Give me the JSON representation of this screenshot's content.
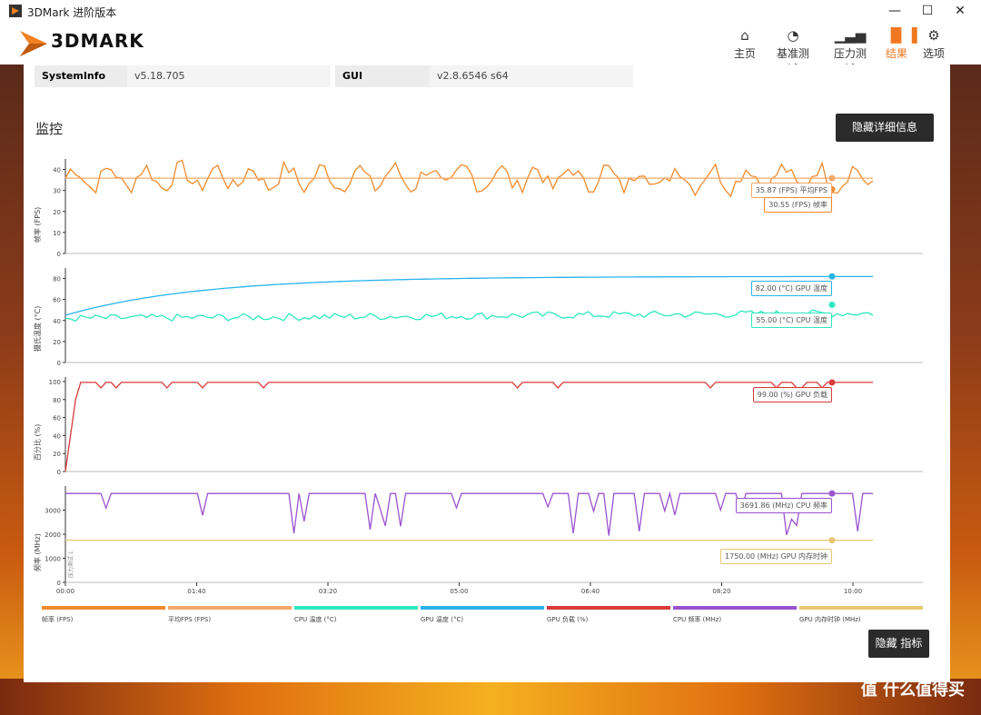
{
  "window": {
    "title": "3DMark 进阶版本",
    "minimize": "—",
    "maximize": "☐",
    "close": "✕"
  },
  "logo": {
    "text": "3DMARK"
  },
  "nav": [
    {
      "label": "主页",
      "icon": "home-icon",
      "glyph": "⌂"
    },
    {
      "label": "基准测试",
      "icon": "gauge-icon",
      "glyph": "◔"
    },
    {
      "label": "压力测试",
      "icon": "bars-icon",
      "glyph": "▁▃▅"
    },
    {
      "label": "结果",
      "icon": "results-icon",
      "glyph": "▐▌▐",
      "active": true
    },
    {
      "label": "选项",
      "icon": "gear-icon",
      "glyph": "⚙"
    }
  ],
  "info": {
    "systeminfo_label": "SystemInfo",
    "systeminfo_value": "v5.18.705",
    "gui_label": "GUI",
    "gui_value": "v2.8.6546 s64"
  },
  "monitor": {
    "title": "监控",
    "hide_details": "隐藏详细信息",
    "hide_metrics": "隐藏 指标"
  },
  "colors": {
    "fps": "#f08a2c",
    "avg_fps": "#f5a868",
    "cpu_temp": "#2ee8c0",
    "gpu_temp": "#29b3ef",
    "gpu_load": "#d93a3a",
    "cpu_clock": "#9a52d0",
    "gpu_mem_clock": "#e8c872"
  },
  "watermark": "值 什么值得买",
  "chart_data": {
    "type": "line",
    "x_ticks": [
      "00:00",
      "01:40",
      "03:20",
      "05:00",
      "06:40",
      "08:20",
      "10:00"
    ],
    "marker_label": "压力测试 1",
    "panels": [
      {
        "ylabel": "帧率 (FPS)",
        "yticks": [
          "0",
          "10",
          "20",
          "30",
          "40"
        ],
        "ylim": [
          0,
          45
        ],
        "series": [
          {
            "name": "帧率 (FPS)",
            "color": "#f08a2c",
            "pattern": "fps",
            "base": 36,
            "amp": 8
          },
          {
            "name": "平均FPS (FPS)",
            "color": "#f5a868",
            "pattern": "flat",
            "base": 35.87
          }
        ],
        "tags": [
          {
            "text": "35.87 (FPS) 平均FPS",
            "color": "#f5a868",
            "value": 35.87
          },
          {
            "text": "30.55 (FPS) 帧率",
            "color": "#f08a2c",
            "value": 30.55
          }
        ]
      },
      {
        "ylabel": "摄氏温度 (°C)",
        "yticks": [
          "0",
          "20",
          "40",
          "60",
          "80"
        ],
        "ylim": [
          0,
          90
        ],
        "series": [
          {
            "name": "GPU 温度 (°C)",
            "color": "#29b3ef",
            "pattern": "warmup",
            "base": 82,
            "start": 45
          },
          {
            "name": "CPU 温度 (°C)",
            "color": "#2ee8c0",
            "pattern": "noisy",
            "base": 42,
            "amp": 7
          }
        ],
        "tags": [
          {
            "text": "82.00 (°C) GPU 温度",
            "color": "#29b3ef",
            "value": 82.0
          },
          {
            "text": "55.00 (°C) CPU 温度",
            "color": "#2ee8c0",
            "value": 55.0
          }
        ]
      },
      {
        "ylabel": "百分比 (%)",
        "yticks": [
          "0",
          "20",
          "40",
          "60",
          "80",
          "100"
        ],
        "ylim": [
          0,
          105
        ],
        "series": [
          {
            "name": "GPU 负载 (%)",
            "color": "#d93a3a",
            "pattern": "load",
            "base": 99
          }
        ],
        "tags": [
          {
            "text": "99.00 (%) GPU 负载",
            "color": "#d93a3a",
            "value": 99.0
          }
        ]
      },
      {
        "ylabel": "频率 (MHz)",
        "yticks": [
          "0",
          "1000",
          "2000",
          "3000"
        ],
        "ylim": [
          0,
          4000
        ],
        "series": [
          {
            "name": "CPU 频率 (MHz)",
            "color": "#9a52d0",
            "pattern": "cpuclock",
            "base": 3691.86
          },
          {
            "name": "GPU 内存时钟 (MHz)",
            "color": "#e8c872",
            "pattern": "flat",
            "base": 1750
          }
        ],
        "tags": [
          {
            "text": "3691.86 (MHz) CPU 频率",
            "color": "#9a52d0",
            "value": 3691.86
          },
          {
            "text": "1750.00 (MHz) GPU 内存时钟",
            "color": "#e8c872",
            "value": 1750.0
          }
        ]
      }
    ],
    "legend": [
      {
        "name": "帧率 (FPS)",
        "color": "#f08a2c"
      },
      {
        "name": "平均FPS (FPS)",
        "color": "#f5a868"
      },
      {
        "name": "CPU 温度 (°C)",
        "color": "#2ee8c0"
      },
      {
        "name": "GPU 温度 (°C)",
        "color": "#29b3ef"
      },
      {
        "name": "GPU 负载 (%)",
        "color": "#d93a3a"
      },
      {
        "name": "CPU 频率 (MHz)",
        "color": "#9a52d0"
      },
      {
        "name": "GPU 内存时钟 (MHz)",
        "color": "#e8c872"
      }
    ]
  }
}
